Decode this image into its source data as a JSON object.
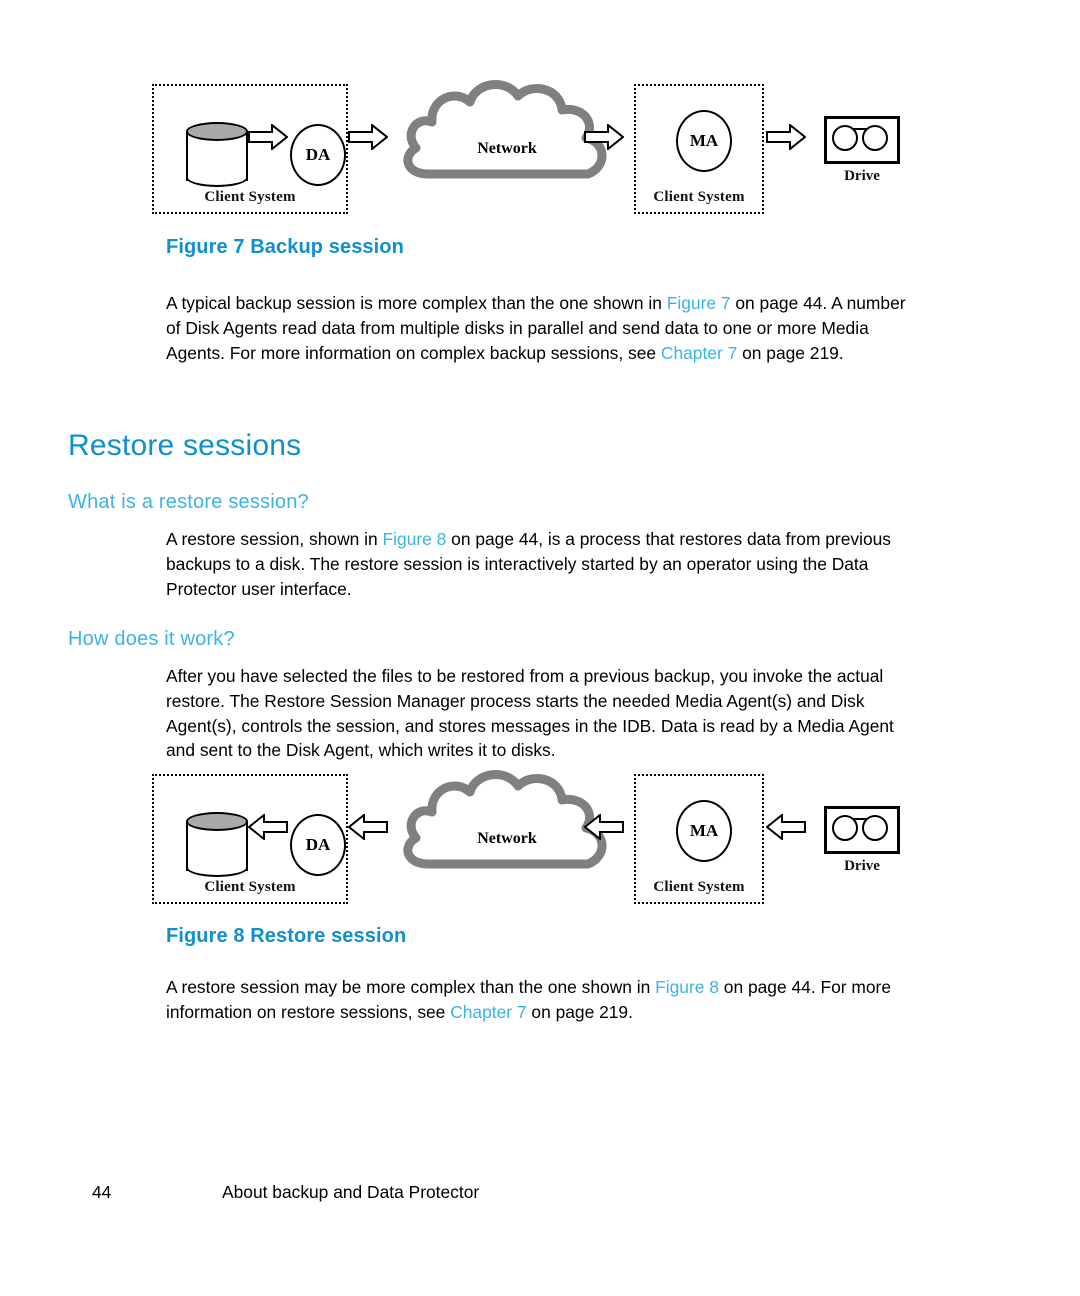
{
  "figure_backup": {
    "caption": "Figure 7 Backup session",
    "client_left_label": "Client System",
    "client_right_label": "Client System",
    "disk_agent_label": "DA",
    "media_agent_label": "MA",
    "network_label": "Network",
    "drive_label": "Drive",
    "flow_direction": "right"
  },
  "figure_restore": {
    "caption": "Figure 8 Restore session",
    "client_left_label": "Client System",
    "client_right_label": "Client System",
    "disk_agent_label": "DA",
    "media_agent_label": "MA",
    "network_label": "Network",
    "drive_label": "Drive",
    "flow_direction": "left"
  },
  "paragraphs": {
    "backup_intro_1": "A typical backup session is more complex than the one shown in ",
    "backup_intro_xref1": "Figure 7",
    "backup_intro_2": " on page 44. A number of Disk Agents read data from multiple disks in parallel and send data to one or more Media Agents. For more information on complex backup sessions, see ",
    "backup_intro_xref2": "Chapter 7",
    "backup_intro_3": " on page 219.",
    "what_1": "A restore session, shown in ",
    "what_xref1": "Figure 8",
    "what_2": " on page 44, is a process that restores data from previous backups to a disk. The restore session is interactively started by an operator using the Data Protector user interface.",
    "how_1": "After you have selected the files to be restored from a previous backup, you invoke the actual restore. The Restore Session Manager process starts the needed Media Agent(s) and Disk Agent(s), controls the session, and stores messages in the IDB. Data is read by a Media Agent and sent to the Disk Agent, which writes it to disks.",
    "restore_more_1": "A restore session may be more complex than the one shown in ",
    "restore_more_xref1": "Figure 8",
    "restore_more_2": " on page 44. For more information on restore sessions, see ",
    "restore_more_xref2": "Chapter 7",
    "restore_more_3": " on page 219."
  },
  "headings": {
    "section_title": "Restore sessions",
    "sub_what": "What is a restore session?",
    "sub_how": "How does it work?"
  },
  "footer": {
    "page_number": "44",
    "chapter_title": "About backup and Data Protector"
  },
  "colors": {
    "heading_blue": "#0f8fce",
    "subheading_blue": "#3cb3e5",
    "cloud_grey": "#808080",
    "disk_top_grey": "#a9a9a9"
  }
}
